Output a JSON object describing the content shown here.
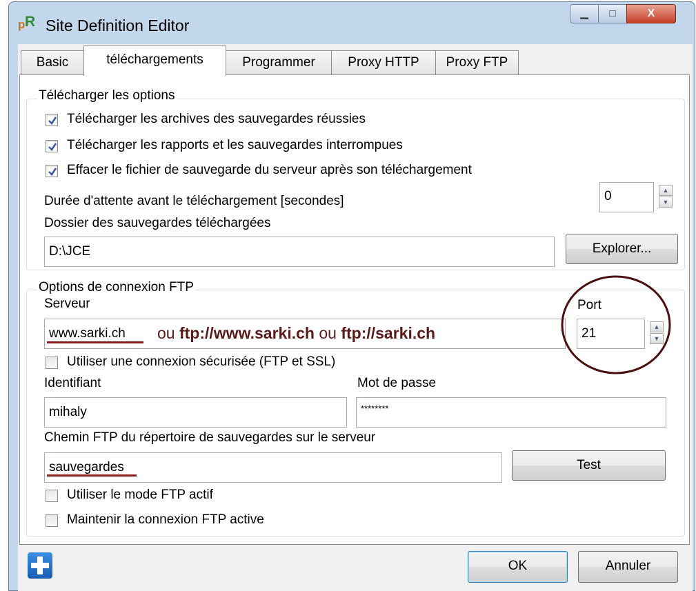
{
  "window": {
    "title": "Site Definition Editor",
    "controls": {
      "minimize": "▭",
      "maximize": "□",
      "close": "X"
    }
  },
  "tabs": [
    {
      "label": "Basic"
    },
    {
      "label": "téléchargements"
    },
    {
      "label": "Programmer"
    },
    {
      "label": "Proxy HTTP"
    },
    {
      "label": "Proxy FTP"
    }
  ],
  "download": {
    "legend": "Télécharger les options",
    "options": [
      {
        "label": "Télécharger les archives des sauvegardes réussies",
        "checked": true
      },
      {
        "label": "Télécharger les rapports et les sauvegardes interrompues",
        "checked": true
      },
      {
        "label": "Effacer le fichier de sauvegarde du serveur après son téléchargement",
        "checked": true
      }
    ],
    "wait_label": "Durée d'attente avant le téléchargement [secondes]",
    "wait_value": "0",
    "folder_label": "Dossier des sauvegardes téléchargées",
    "folder_value": "D:\\JCE",
    "explore_button": "Explorer..."
  },
  "ftp": {
    "legend": "Options de connexion FTP",
    "server_label": "Serveur",
    "server_value": "www.sarki.ch",
    "server_hint_or1": "ou",
    "server_hint_url1": "ftp://www.sarki.ch",
    "server_hint_or2": "ou",
    "server_hint_url2": "ftp://sarki.ch",
    "port_label": "Port",
    "port_value": "21",
    "secure_label": "Utiliser une connexion sécurisée (FTP et SSL)",
    "secure_checked": false,
    "user_label": "Identifiant",
    "user_value": "mihaly",
    "password_label": "Mot de passe",
    "password_value": "********",
    "path_label": "Chemin FTP du répertoire de sauvegardes sur le serveur",
    "path_value": "sauvegardes",
    "test_button": "Test",
    "active_mode_label": "Utiliser le mode FTP actif",
    "keepalive_label": "Maintenir la connexion FTP active"
  },
  "footer": {
    "ok": "OK",
    "cancel": "Annuler"
  },
  "colors": {
    "annotation": "#5a1a1a",
    "help_icon": "#1a6fc2"
  }
}
